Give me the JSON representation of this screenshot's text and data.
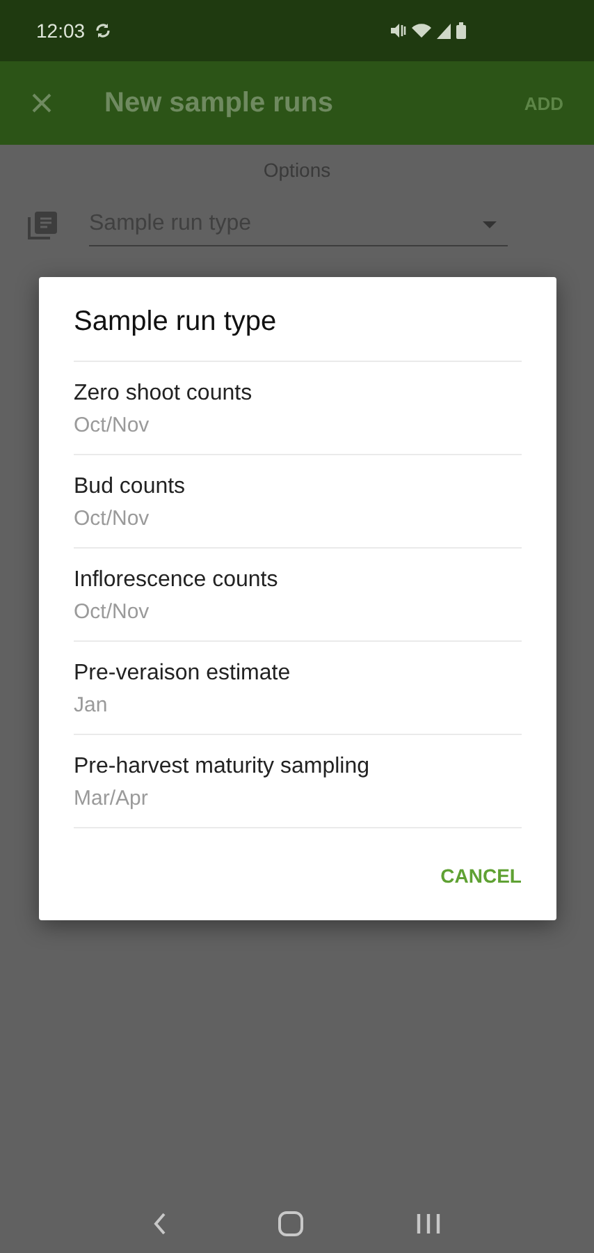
{
  "status_bar": {
    "time": "12:03"
  },
  "toolbar": {
    "title": "New sample runs",
    "action": {
      "label": "ADD",
      "disabled": true
    }
  },
  "section_title": "Options",
  "field": {
    "placeholder": "Sample run type"
  },
  "dialog": {
    "title": "Sample run type",
    "options": [
      {
        "title": "Zero shoot counts",
        "subtitle": "Oct/Nov"
      },
      {
        "title": "Bud counts",
        "subtitle": "Oct/Nov"
      },
      {
        "title": "Inflorescence counts",
        "subtitle": "Oct/Nov"
      },
      {
        "title": "Pre-veraison estimate",
        "subtitle": "Jan"
      },
      {
        "title": "Pre-harvest maturity sampling",
        "subtitle": "Mar/Apr"
      }
    ],
    "buttons": [
      "CANCEL"
    ]
  }
}
